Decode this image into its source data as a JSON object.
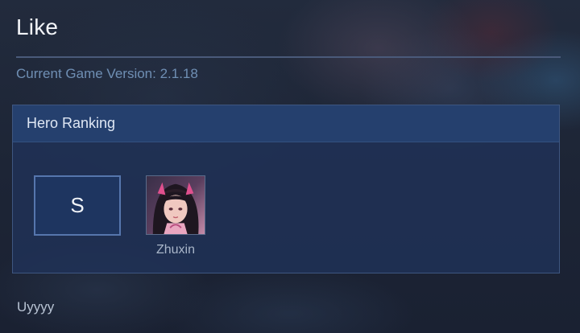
{
  "page": {
    "title": "Like",
    "version_label": "Current Game Version: 2.1.18"
  },
  "ranking": {
    "header": "Hero Ranking",
    "tier": "S",
    "heroes": [
      {
        "name": "Zhuxin",
        "icon": "hero-portrait-icon"
      }
    ]
  },
  "footer": {
    "text": "Uyyyy"
  }
}
